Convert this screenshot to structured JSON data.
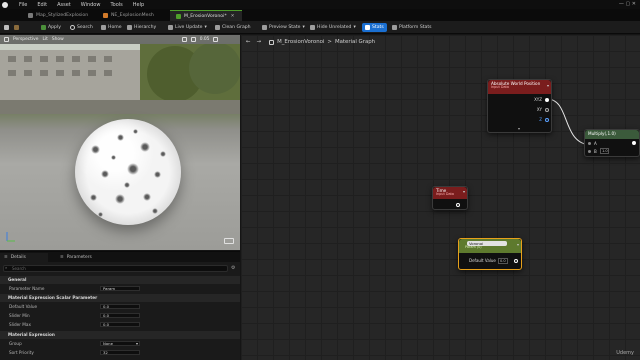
{
  "menu": [
    "File",
    "Edit",
    "Asset",
    "Window",
    "Tools",
    "Help"
  ],
  "tabs": [
    {
      "label": "Map_StylizedExplosion",
      "active": false
    },
    {
      "label": "NE_ExplosionMesh",
      "active": false
    },
    {
      "label": "M_ErosionVoronoi*",
      "active": true
    }
  ],
  "toolbar": {
    "apply": "Apply",
    "search": "Search",
    "home": "Home",
    "hierarchy": "Hierarchy",
    "live_update": "Live Update",
    "clean_graph": "Clean Graph",
    "preview_state": "Preview State",
    "hide_unrelated": "Hide Unrelated",
    "stats": "Stats",
    "platform_stats": "Platform Stats"
  },
  "viewport": {
    "perspective": "Perspective",
    "lit": "Lit",
    "show": "Show",
    "fov": "0.05"
  },
  "details": {
    "tabs": [
      "Details",
      "Parameters"
    ],
    "search_placeholder": "Search",
    "sections": [
      {
        "title": "General",
        "rows": [
          {
            "label": "Parameter Name",
            "value": "Param"
          }
        ]
      },
      {
        "title": "Material Expression Scalar Parameter",
        "rows": [
          {
            "label": "Default Value",
            "value": "0.0"
          },
          {
            "label": "Slider Min",
            "value": "0.0"
          },
          {
            "label": "Slider Max",
            "value": "0.0"
          }
        ]
      },
      {
        "title": "Material Expression",
        "rows": [
          {
            "label": "Group",
            "value": "None"
          },
          {
            "label": "Sort Priority",
            "value": "32"
          }
        ]
      }
    ]
  },
  "graph": {
    "breadcrumb_asset": "M_ErosionVoronoi",
    "breadcrumb_sep": ">",
    "breadcrumb_graph": "Material Graph",
    "nodes": {
      "absolute_world_position": {
        "title": "Absolute World Position",
        "subtitle": "Input Data",
        "pins": [
          "XYZ",
          "XY",
          "Z"
        ]
      },
      "multiply": {
        "title": "Multiply(,1.0)",
        "pins": [
          "A",
          "B"
        ],
        "b_value": "1.0"
      },
      "time": {
        "title": "Time",
        "subtitle": "Input Data"
      },
      "voronoi": {
        "title": "Voronoi",
        "subtitle": "Param (0)",
        "pin": "Default Value",
        "value": "0.0"
      }
    }
  },
  "watermark": "Udemy"
}
